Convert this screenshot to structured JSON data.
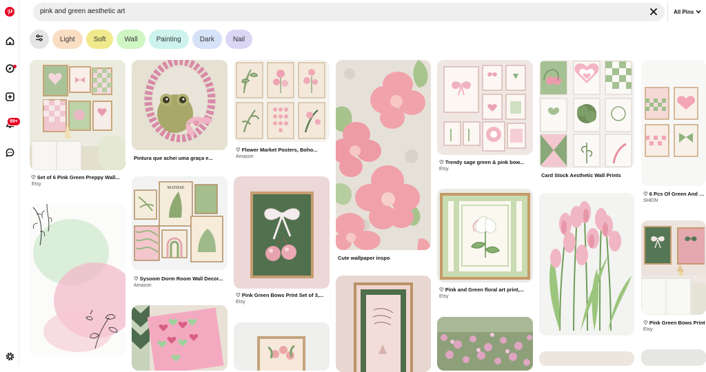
{
  "search": {
    "query": "pink and green aesthetic art",
    "scope_label": "All Pins"
  },
  "sidebar": {
    "notification_count": "99+",
    "icons": [
      "pinterest-logo-icon",
      "home-icon",
      "explore-icon",
      "create-icon",
      "notifications-icon",
      "messages-icon",
      "settings-icon"
    ]
  },
  "filters": [
    {
      "label": "Light",
      "color": "#f9dec4"
    },
    {
      "label": "Soft",
      "color": "#f1ea8c"
    },
    {
      "label": "Wall",
      "color": "#cff5c3"
    },
    {
      "label": "Painting",
      "color": "#cdf3ec"
    },
    {
      "label": "Dark",
      "color": "#d6e2f7"
    },
    {
      "label": "Nail",
      "color": "#dcd6f5"
    }
  ],
  "pins": {
    "p1": {
      "title": "Set of 6 Pink Green Preppy Wall...",
      "source": "Etsy"
    },
    "p3": {
      "title": "Pintura que achei uma graça e..."
    },
    "p4": {
      "title": "Sysoom Dorm Room Wall Decor...",
      "source": "Amazon"
    },
    "p6": {
      "title": "Flower Market Posters, Boho...",
      "source": "Amazon"
    },
    "p7": {
      "title": "Pink Green Bows Print Set of 3,...",
      "source": "Etsy"
    },
    "p9": {
      "title": "Cute wallpaper inspo"
    },
    "p11": {
      "title": "Trendy sage green & pink bow...",
      "source": "Etsy"
    },
    "p12": {
      "title": "Pink and Green floral art print,...",
      "source": "Etsy"
    },
    "p14": {
      "title": "Card Stock Aesthetic Wall Prints"
    },
    "p17": {
      "title": "6 Pcs Of Green And Pi...",
      "source": "SHEIN"
    },
    "p18": {
      "title": "Pink Green Bows Print",
      "source": "Etsy"
    }
  },
  "images": {
    "matisse_text": "MATISSE"
  }
}
